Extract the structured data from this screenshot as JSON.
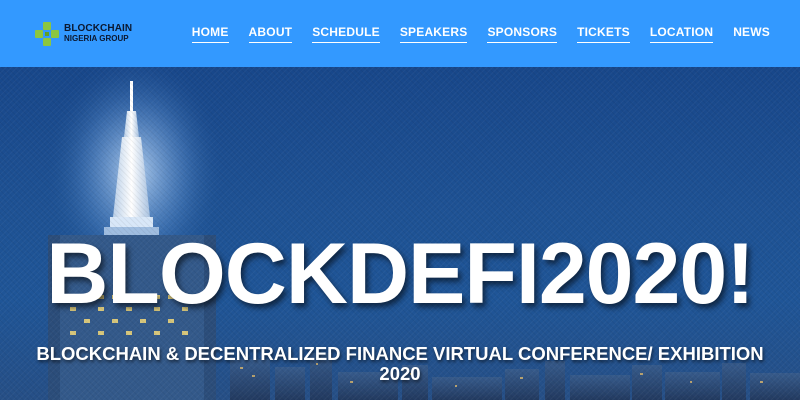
{
  "header": {
    "logo": {
      "line1": "BLOCKCHAIN",
      "line2": "NIGERIA GROUP",
      "icon": "blockchain-logo-icon",
      "icon_color": "#8cc63f"
    },
    "nav": [
      {
        "label": "HOME"
      },
      {
        "label": "ABOUT"
      },
      {
        "label": "SCHEDULE"
      },
      {
        "label": "SPEAKERS"
      },
      {
        "label": "SPONSORS"
      },
      {
        "label": "TICKETS"
      },
      {
        "label": "LOCATION"
      },
      {
        "label": "NEWS"
      }
    ],
    "background_color": "#3399ff"
  },
  "hero": {
    "title": "BLOCKDEFI2020!",
    "subtitle_line1": "BLOCKCHAIN & DECENTRALIZED FINANCE VIRTUAL CONFERENCE/ EXHIBITION",
    "subtitle_line2": "2020",
    "background": "city-skyline-tower-night-photo"
  }
}
